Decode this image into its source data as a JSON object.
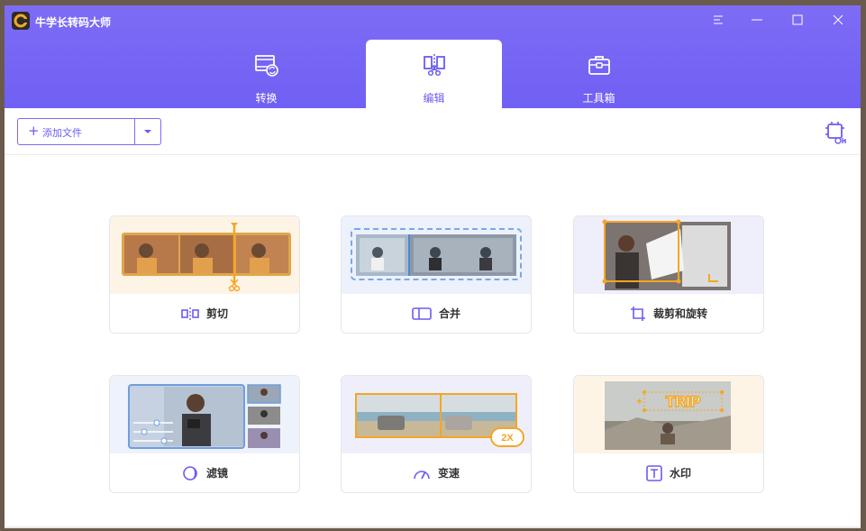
{
  "app": {
    "title": "牛学长转码大师"
  },
  "tabs": [
    {
      "label": "转换",
      "icon": "film-convert-icon",
      "active": false
    },
    {
      "label": "编辑",
      "icon": "edit-cut-icon",
      "active": true
    },
    {
      "label": "工具箱",
      "icon": "toolbox-icon",
      "active": false
    }
  ],
  "toolbar": {
    "add_file_label": "添加文件",
    "hardware_icon": "hardware-acceleration-icon"
  },
  "cards": [
    {
      "label": "剪切",
      "icon": "split-icon"
    },
    {
      "label": "合并",
      "icon": "merge-icon"
    },
    {
      "label": "裁剪和旋转",
      "icon": "crop-icon"
    },
    {
      "label": "滤镜",
      "icon": "filter-icon"
    },
    {
      "label": "变速",
      "icon": "speed-gauge-icon"
    },
    {
      "label": "水印",
      "icon": "text-watermark-icon"
    }
  ],
  "thumbnails": {
    "speed_badge": "2X",
    "watermark_text": "TRIP"
  },
  "colors": {
    "accent": "#6c5cf1",
    "header": "#7565f4",
    "orange": "#f5a623"
  }
}
